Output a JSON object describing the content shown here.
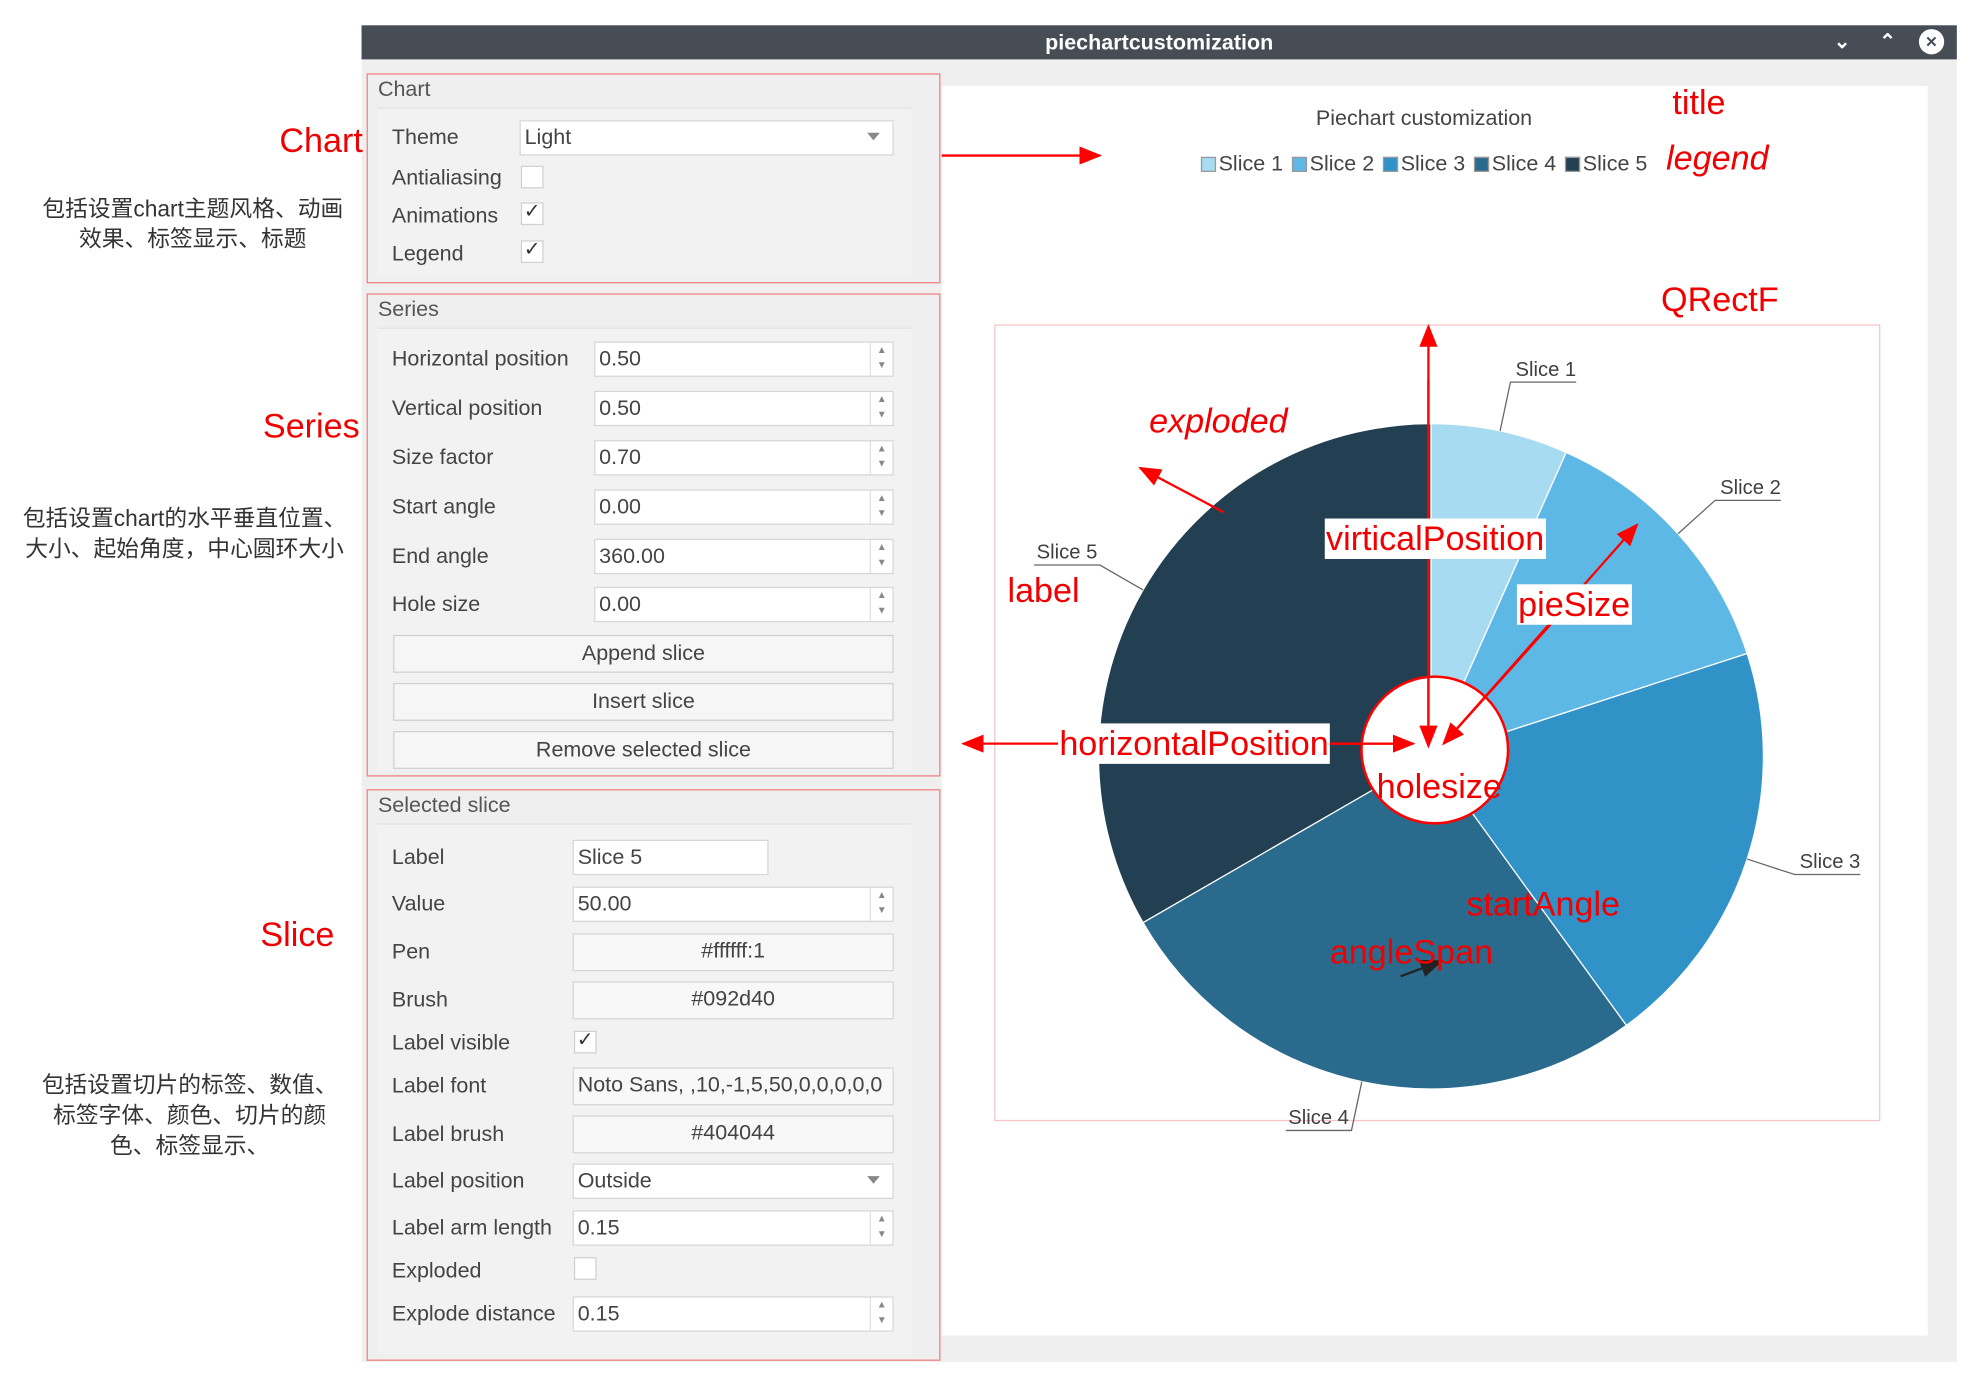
{
  "window": {
    "title": "piechartcustomization"
  },
  "chart_group": {
    "title": "Chart",
    "theme_label": "Theme",
    "theme_value": "Light",
    "antialiasing_label": "Antialiasing",
    "antialiasing": false,
    "animations_label": "Animations",
    "animations": true,
    "legend_label": "Legend",
    "legend": true
  },
  "series_group": {
    "title": "Series",
    "fields": [
      {
        "label": "Horizontal position",
        "value": "0.50"
      },
      {
        "label": "Vertical position",
        "value": "0.50"
      },
      {
        "label": "Size factor",
        "value": "0.70"
      },
      {
        "label": "Start angle",
        "value": "0.00"
      },
      {
        "label": "End angle",
        "value": "360.00"
      },
      {
        "label": "Hole size",
        "value": "0.00"
      }
    ],
    "append_label": "Append slice",
    "insert_label": "Insert slice",
    "remove_label": "Remove selected slice"
  },
  "slice_group": {
    "title": "Selected slice",
    "label_label": "Label",
    "label_value": "Slice 5",
    "value_label": "Value",
    "value_value": "50.00",
    "pen_label": "Pen",
    "pen_value": "#ffffff:1",
    "brush_label": "Brush",
    "brush_value": "#092d40",
    "label_visible_label": "Label visible",
    "label_visible": true,
    "label_font_label": "Label font",
    "label_font_value": "Noto Sans, ,10,-1,5,50,0,0,0,0,0",
    "label_brush_label": "Label brush",
    "label_brush_value": "#404044",
    "label_position_label": "Label position",
    "label_position_value": "Outside",
    "arm_label": "Label arm length",
    "arm_value": "0.15",
    "exploded_label": "Exploded",
    "exploded": false,
    "explode_distance_label": "Explode distance",
    "explode_distance_value": "0.15"
  },
  "annotations": {
    "chart": "Chart",
    "chart_desc": "包括设置chart主题风格、动画效果、标签显示、标题",
    "series": "Series",
    "series_desc": "包括设置chart的水平垂直位置、大小、起始角度，中心圆环大小",
    "slice": "Slice",
    "slice_desc": "包括设置切片的标签、数值、标签字体、颜色、切片的颜色、标签显示、",
    "title": "title",
    "legend": "legend",
    "qrectf": "QRectF",
    "exploded": "exploded",
    "label": "label",
    "vertical": "virticalPosition",
    "piesize": "pieSize",
    "horizontal": "horizontalPosition",
    "holesize": "holesize",
    "startangle": "startAngle",
    "anglespan": "angleSpan"
  },
  "chart_data": {
    "type": "pie",
    "title": "Piechart customization",
    "categories": [
      "Slice 1",
      "Slice 2",
      "Slice 3",
      "Slice 4",
      "Slice 5"
    ],
    "values": [
      10,
      20,
      30,
      40,
      50
    ],
    "colors": [
      "#a7dbf2",
      "#5db8e6",
      "#3192c8",
      "#2a6b8d",
      "#233f52"
    ],
    "legend": "top",
    "label_position": "outside"
  }
}
